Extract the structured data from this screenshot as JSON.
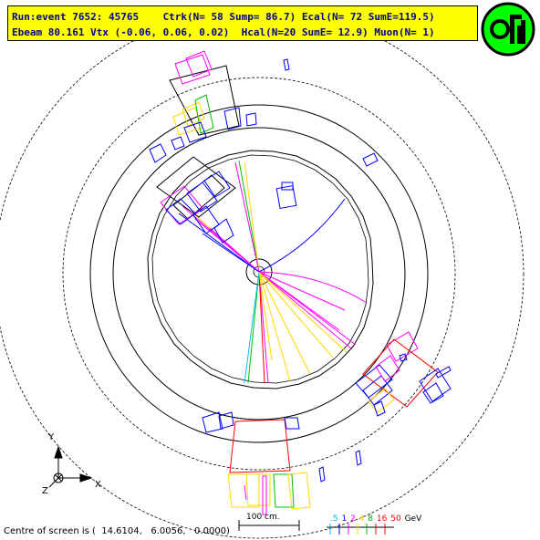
{
  "header": {
    "line1": "Run:event 7652: 45765    Ctrk(N= 58 Sump= 86.7) Ecal(N= 72 SumE=119.5)",
    "line2": "Ebeam 80.161 Vtx (-0.06, 0.06, 0.02)  Hcal(N=20 SumE= 12.9) Muon(N= 1)"
  },
  "logo": {
    "text": "OPAL",
    "colors": {
      "ring": "#000000",
      "fill": "#00ff00"
    }
  },
  "axes": {
    "y": "Y",
    "x": "X",
    "z": "Z"
  },
  "scale": {
    "label": "100 cm."
  },
  "energy_scale": {
    "items": [
      {
        "label": ".5",
        "color": "#00c0ff"
      },
      {
        "label": "1",
        "color": "#0000ff"
      },
      {
        "label": "2",
        "color": "#ff00ff"
      },
      {
        "label": "4",
        "color": "#ffd700"
      },
      {
        "label": "8",
        "color": "#00b000"
      },
      {
        "label": "16",
        "color": "#ff0000"
      },
      {
        "label": "50",
        "color": "#ff0000"
      }
    ],
    "unit": "GeV"
  },
  "footer": {
    "text": "Centre of screen is (  14.6104,   6.0056,   0.0000)"
  },
  "colors": {
    "track_magenta": "#ff00ff",
    "track_yellow": "#ffd700",
    "track_green": "#00c000",
    "track_blue": "#0000ff",
    "hadron_red": "#ff0000",
    "detector": "#000000"
  }
}
